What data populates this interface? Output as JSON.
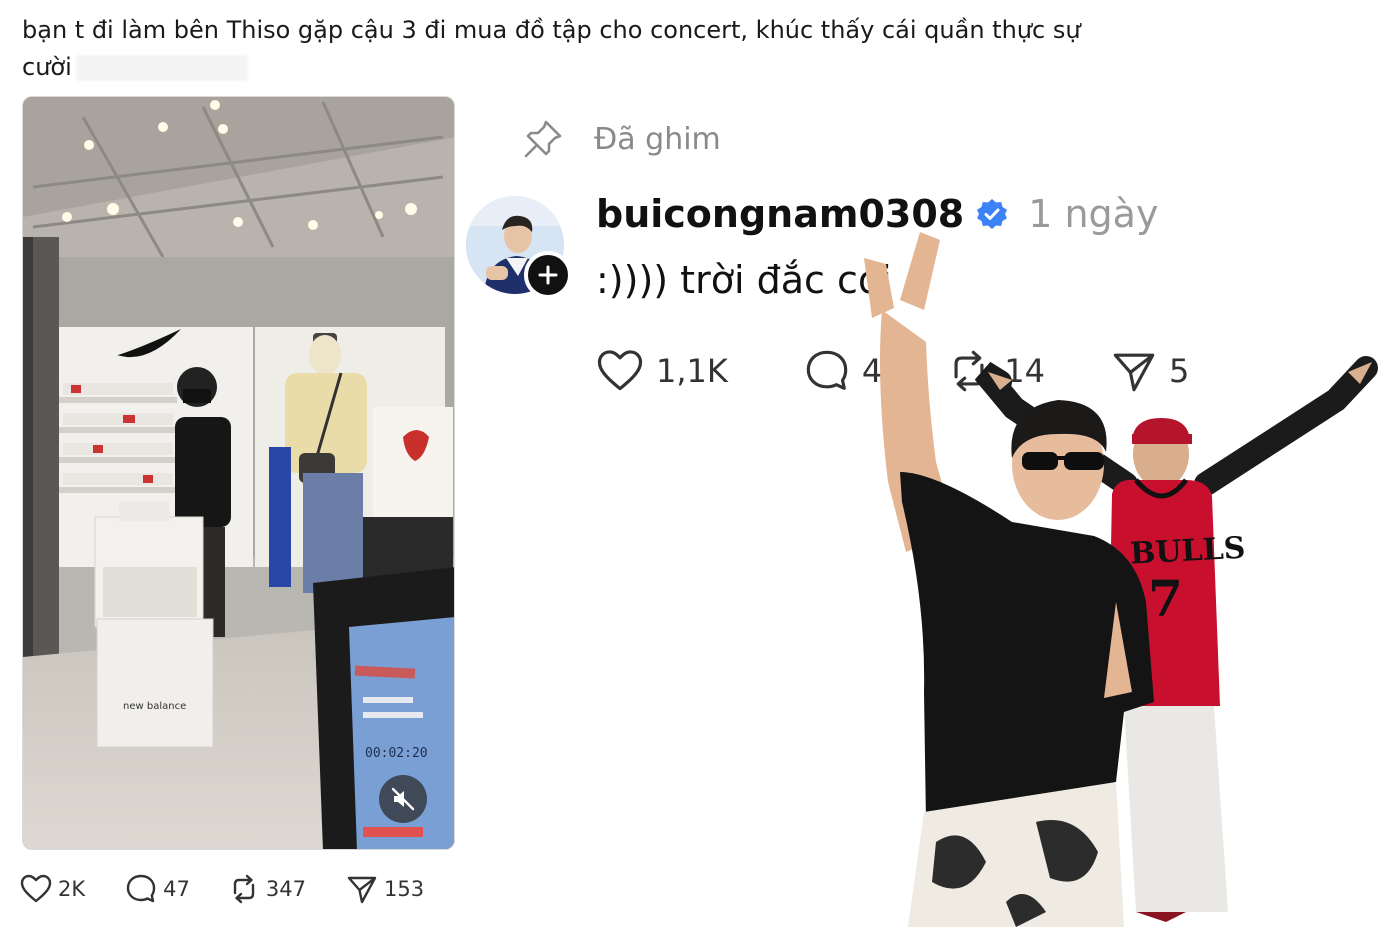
{
  "post": {
    "caption_line1": "bạn t đi làm bên Thiso gặp cậu 3 đi mua đồ tập cho concert, khúc thấy cái quần thực sự",
    "caption_line2": "cười",
    "video": {
      "store_sign": "new balance",
      "timer_text": "00:02:20",
      "mute_icon": "volume-muted-icon"
    },
    "actions": {
      "likes": "2K",
      "comments": "47",
      "reposts": "347",
      "shares": "153"
    }
  },
  "thread": {
    "pinned_label": "Đã ghim",
    "username": "buicongnam0308",
    "time": "1 ngày",
    "text": ":)))) trời đắc cơi",
    "actions": {
      "likes": "1,1K",
      "comments": "4",
      "reposts": "14",
      "shares": "5"
    }
  },
  "overlay": {
    "jersey_text": "BULLS",
    "jersey_number": "7"
  },
  "colors": {
    "verified": "#3b82f6",
    "muted_text": "#9a9a9a",
    "jersey": "#c8102e"
  }
}
